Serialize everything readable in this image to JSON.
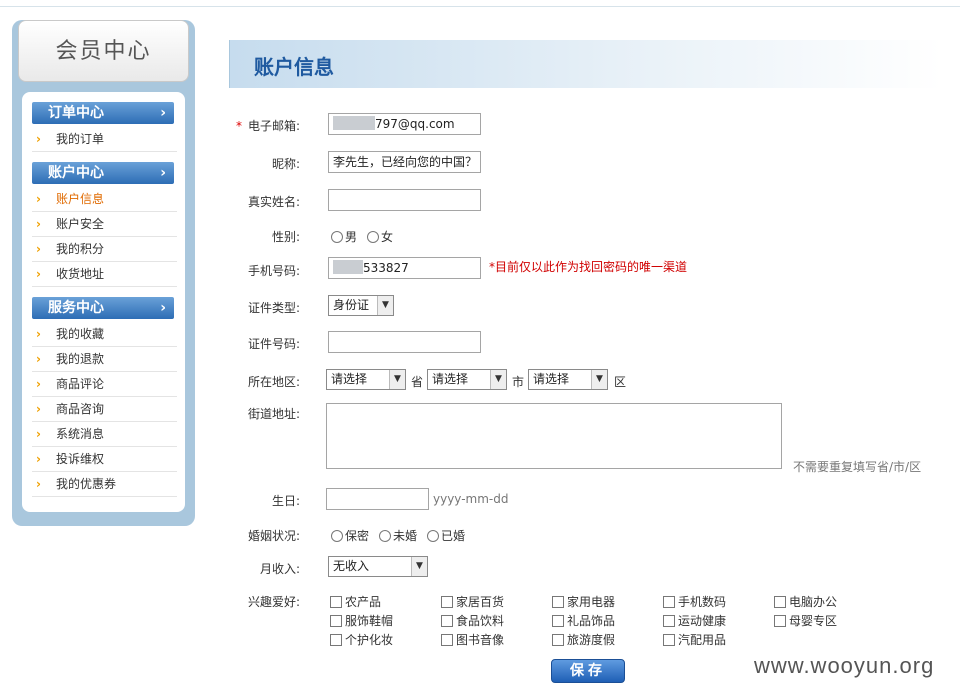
{
  "sidebar": {
    "title": "会员中心",
    "sections": [
      {
        "title": "订单中心",
        "items": [
          "我的订单"
        ]
      },
      {
        "title": "账户中心",
        "items": [
          "账户信息",
          "账户安全",
          "我的积分",
          "收货地址"
        ]
      },
      {
        "title": "服务中心",
        "items": [
          "我的收藏",
          "我的退款",
          "商品评论",
          "商品咨询",
          "系统消息",
          "投诉维权",
          "我的优惠券"
        ]
      }
    ],
    "active_item": "账户信息"
  },
  "page": {
    "title": "账户信息"
  },
  "form": {
    "email": {
      "label": "电子邮箱:",
      "required_mark": "*",
      "value_suffix": "797@qq.com"
    },
    "nickname": {
      "label": "昵称:",
      "value": "李先生，已经向您的中国？"
    },
    "realname": {
      "label": "真实姓名:",
      "value": ""
    },
    "gender": {
      "label": "性别:",
      "options": [
        "男",
        "女"
      ]
    },
    "mobile": {
      "label": "手机号码:",
      "value_suffix": "533827",
      "hint": "*目前仅以此作为找回密码的唯一渠道"
    },
    "id_type": {
      "label": "证件类型:",
      "selected": "身份证"
    },
    "id_number": {
      "label": "证件号码:",
      "value": ""
    },
    "region": {
      "label": "所在地区:",
      "province": "请选择",
      "province_unit": "省",
      "city": "请选择",
      "city_unit": "市",
      "district": "请选择",
      "district_unit": "区"
    },
    "street": {
      "label": "街道地址:",
      "hint": "不需要重复填写省/市/区"
    },
    "birthday": {
      "label": "生日:",
      "hint": "yyyy-mm-dd"
    },
    "marital": {
      "label": "婚姻状况:",
      "options": [
        "保密",
        "未婚",
        "已婚"
      ]
    },
    "income": {
      "label": "月收入:",
      "selected": "无收入"
    },
    "hobbies": {
      "label": "兴趣爱好:",
      "rows": [
        [
          "农产品",
          "家居百货",
          "家用电器",
          "手机数码",
          "电脑办公"
        ],
        [
          "服饰鞋帽",
          "食品饮料",
          "礼品饰品",
          "运动健康",
          "母婴专区"
        ],
        [
          "个护化妆",
          "图书音像",
          "旅游度假",
          "汽配用品"
        ]
      ]
    },
    "save_label": "保存"
  },
  "watermark": "www.wooyun.org"
}
